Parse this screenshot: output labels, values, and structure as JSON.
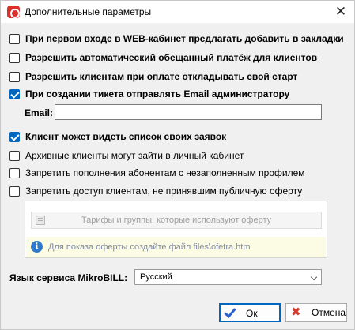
{
  "window": {
    "title": "Дополнительные параметры",
    "close_glyph": "✕",
    "app_icon": "app-logo-icon"
  },
  "options": [
    {
      "label": "При первом входе в WEB-кабинет предлагать добавить в закладки",
      "checked": false,
      "bold": true
    },
    {
      "label": "Разрешить автоматический обещанный платёж для клиентов",
      "checked": false,
      "bold": true
    },
    {
      "label": "Разрешить клиентам при оплате откладывать свой старт",
      "checked": false,
      "bold": true
    },
    {
      "label": "При создании тикета отправлять Email администратору",
      "checked": true,
      "bold": true
    },
    {
      "label": "Клиент может видеть список своих заявок",
      "checked": true,
      "bold": true
    },
    {
      "label": "Архивные клиенты могут зайти в личный кабинет",
      "checked": false,
      "bold": false
    },
    {
      "label": "Запретить пополнения абонентам с незаполненным профилем",
      "checked": false,
      "bold": false
    },
    {
      "label": "Запретить доступ клиентам, не принявшим публичную оферту",
      "checked": false,
      "bold": false
    }
  ],
  "email": {
    "label": "Email:",
    "value": ""
  },
  "offer": {
    "tariff_button_label": "Тарифы и группы, которые используют оферту",
    "info_text": "Для показа оферты создайте файл files\\ofetra.htm"
  },
  "language": {
    "label": "Язык сервиса MikroBILL:",
    "selected": "Русский"
  },
  "buttons": {
    "ok_label": "Ок",
    "cancel_label": "Отмена"
  },
  "colors": {
    "accent": "#0067c0",
    "info_bg": "#fcfbe3",
    "info_text": "#7f8aa6",
    "app_icon": "#d9302c"
  }
}
